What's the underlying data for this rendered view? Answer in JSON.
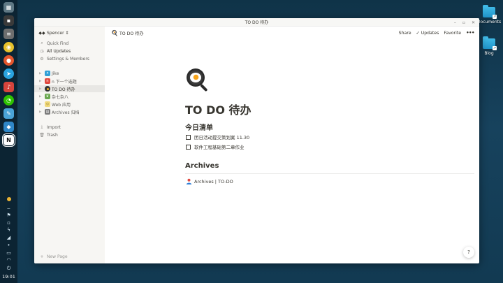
{
  "window": {
    "title": "TO DO 待办",
    "controls": [
      "–",
      "▫",
      "✕"
    ]
  },
  "sidebar": {
    "workspace": "Spencer ⇕",
    "top_items": [
      {
        "icon": "search-icon",
        "label": "Quick Find"
      },
      {
        "icon": "clock-icon",
        "label": "All Updates"
      },
      {
        "icon": "gear-icon",
        "label": "Settings & Members"
      }
    ],
    "pages": [
      {
        "emoji": "🐦",
        "label": "Jike"
      },
      {
        "emoji": "🅽",
        "label": "n 下一个选题"
      },
      {
        "emoji": "🍳",
        "label": "TO DO 待办"
      },
      {
        "emoji": "🌿",
        "label": "杂七杂八"
      },
      {
        "emoji": "🏷",
        "label": "Web 应用"
      },
      {
        "emoji": "🗄",
        "label": "Archives 归档"
      }
    ],
    "bottom_items": [
      {
        "icon": "import-icon",
        "label": "Import"
      },
      {
        "icon": "trash-icon",
        "label": "Trash"
      }
    ],
    "new_page": "New Page"
  },
  "topbar": {
    "breadcrumb": "TO DO 待办",
    "share": "Share",
    "updates": "Updates",
    "favorite": "Favorite",
    "more": "•••"
  },
  "page": {
    "title": "TO DO 待办",
    "section1": "今日清单",
    "todos": [
      {
        "text": "团日活动提交策划案 11.30",
        "checked": false
      },
      {
        "text": "软件工程基础第二章作业",
        "checked": false
      }
    ],
    "section2": "Archives",
    "archive_link": "Archives | TO-DO"
  },
  "help": "?",
  "desktop": {
    "icons": [
      "Documents",
      "Blog"
    ],
    "clock": "19:01"
  },
  "colors": {
    "sidebar_bg": "#f7f6f3",
    "active_row": "#e8e7e4",
    "text": "#37352f",
    "folder": "#3fb9e6"
  }
}
